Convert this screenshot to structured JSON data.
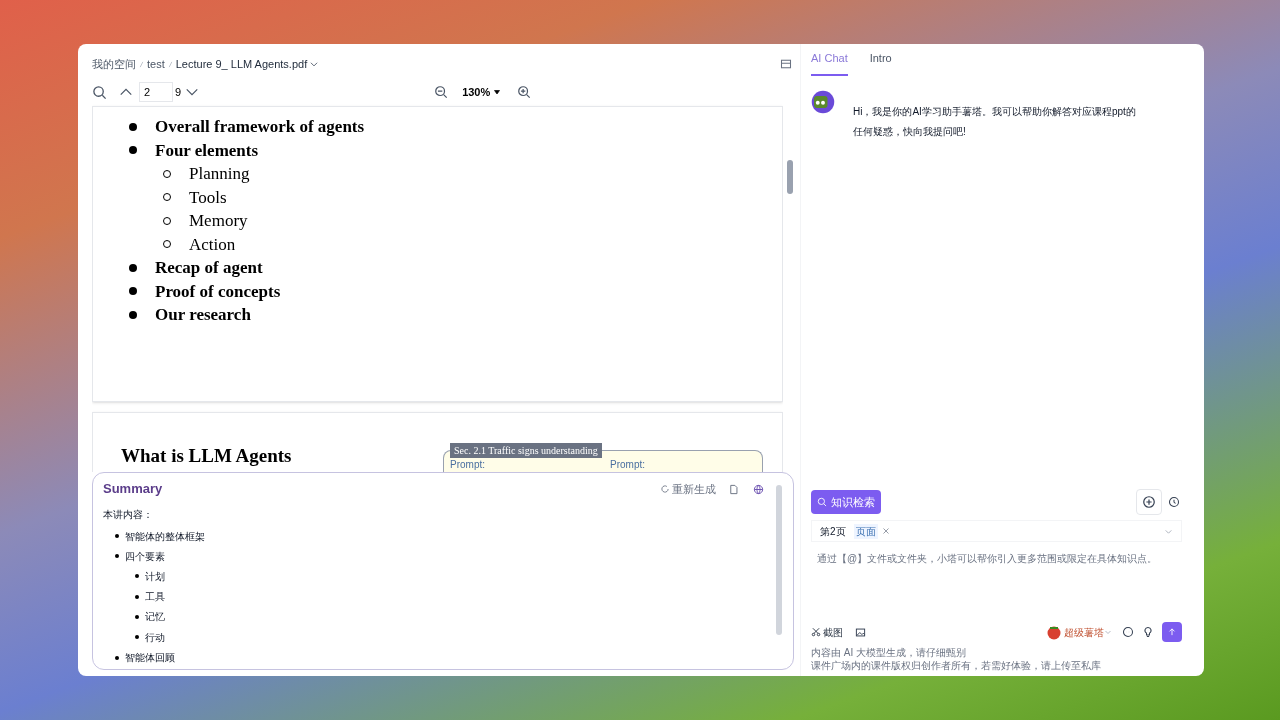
{
  "breadcrumb": [
    "我的空间",
    "test",
    "Lecture 9_ LLM Agents.pdf"
  ],
  "pdf_toolbar": {
    "page": "2",
    "total": "9",
    "zoom": "130%"
  },
  "pdf_page_1": {
    "bullets": [
      {
        "text": "Overall framework of agents"
      },
      {
        "text": "Four elements",
        "children": [
          {
            "text": "Planning"
          },
          {
            "text": "Tools"
          },
          {
            "text": "Memory"
          },
          {
            "text": "Action"
          }
        ]
      },
      {
        "text": "Recap of agent"
      },
      {
        "text": "Proof of concepts"
      },
      {
        "text": "Our research"
      }
    ]
  },
  "pdf_page_2": {
    "heading": "What is LLM Agents",
    "figure_label": "Sec. 2.1 Traffic signs understanding",
    "prompts": [
      "Prompt:",
      "Prompt:"
    ]
  },
  "summary": {
    "title": "Summary",
    "regenerate": "重新生成",
    "intro": "本讲内容：",
    "items": [
      {
        "text": "智能体的整体框架"
      },
      {
        "text": "四个要素",
        "children": [
          {
            "text": "计划"
          },
          {
            "text": "工具"
          },
          {
            "text": "记忆"
          },
          {
            "text": "行动"
          }
        ]
      },
      {
        "text": "智能体回顾"
      }
    ]
  },
  "chat": {
    "tabs": [
      {
        "label": "AI Chat",
        "selected": true
      },
      {
        "label": "Intro",
        "selected": false
      }
    ],
    "message": "Hi，我是你的AI学习助手薯塔。我可以帮助你解答对应课程ppt的任何疑惑，快向我提问吧!"
  },
  "composer": {
    "knowledge_button": "知识检索",
    "context": "第2页",
    "context_tag": "页面",
    "placeholder": "通过【@】文件或文件夹，小塔可以帮你引入更多范围或限定在具体知识点。",
    "screenshot": "截图",
    "model": "超级薯塔"
  },
  "disclaimer": [
    "内容由 AI 大模型生成，请仔细甄别",
    "课件广场内的课件版权归创作者所有，若需好体验，请上传至私库"
  ]
}
